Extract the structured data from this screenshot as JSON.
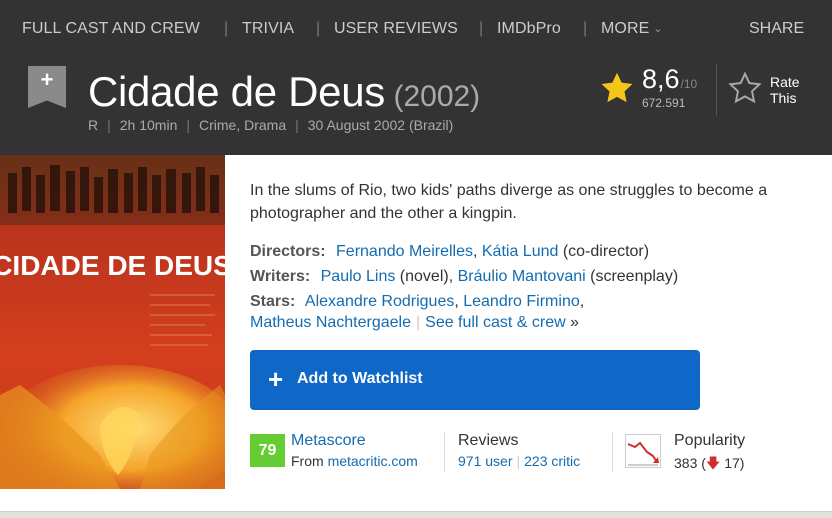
{
  "subnav": {
    "items": [
      "FULL CAST AND CREW",
      "TRIVIA",
      "USER REVIEWS",
      "IMDbPro",
      "MORE"
    ],
    "share": "SHARE"
  },
  "title": {
    "name": "Cidade de Deus",
    "year": "(2002)",
    "bookmark_icon": "plus-icon"
  },
  "meta": {
    "certificate": "R",
    "runtime": "2h 10min",
    "genres": "Crime, Drama",
    "release": "30 August 2002 (Brazil)"
  },
  "rating": {
    "score": "8,6",
    "out_of": "/10",
    "votes": "672.591",
    "rate_line1": "Rate",
    "rate_line2": "This"
  },
  "poster": {
    "title_text": "CIDADE DE DEUS"
  },
  "plot": "In the slums of Rio, two kids' paths diverge as one struggles to become a photographer and the other a kingpin.",
  "credits": {
    "directors_label": "Directors:",
    "director1": "Fernando Meirelles",
    "director2": "Kátia Lund",
    "director2_role": "(co-director)",
    "writers_label": "Writers:",
    "writer1": "Paulo Lins",
    "writer1_role": "(novel)",
    "writer2": "Bráulio Mantovani",
    "writer2_role": "(screenplay)",
    "stars_label": "Stars:",
    "star1": "Alexandre Rodrigues",
    "star2": "Leandro Firmino",
    "star3": "Matheus Nachtergaele",
    "see_full": "See full cast & crew",
    "see_full_arrow": "»"
  },
  "watchlist": {
    "plus": "+",
    "label": "Add to Watchlist"
  },
  "stats": {
    "metascore": "79",
    "metascore_label": "Metascore",
    "from_prefix": "From",
    "from_link": "metacritic.com",
    "reviews_label": "Reviews",
    "user_reviews": "971 user",
    "critic_reviews": "223 critic",
    "popularity_label": "Popularity",
    "popularity_rank": "383",
    "popularity_change": "17"
  },
  "colors": {
    "header_bg": "#333333",
    "star": "#f5c518",
    "watchlist": "#0f67c7",
    "metascore": "#66cc33",
    "link": "#136cb2"
  }
}
